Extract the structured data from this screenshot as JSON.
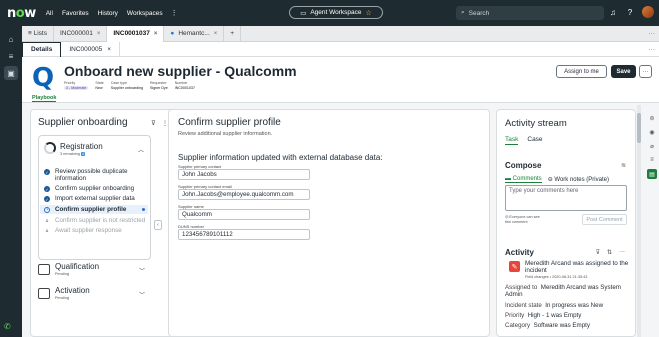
{
  "topnav": {
    "logo_main": "n",
    "logo_o": "o",
    "logo_end": "w",
    "items": [
      "All",
      "Favorites",
      "History",
      "Workspaces"
    ],
    "more": "⋮",
    "workspace_label": "Agent Workspace",
    "workspace_star": "☆",
    "search_placeholder": "Search",
    "icons": [
      "search-icon",
      "bell-icon",
      "help-icon",
      "avatar"
    ]
  },
  "tabs": [
    {
      "label": "≡ Lists"
    },
    {
      "label": "INC000001",
      "close": "×"
    },
    {
      "label": "INC0001037",
      "close": "×"
    },
    {
      "label": "Hemantc...",
      "close": "×"
    },
    {
      "label": "+"
    }
  ],
  "tab_more": "···",
  "subtabs": [
    {
      "label": "Details"
    },
    {
      "label": "INC000005",
      "close": "×"
    }
  ],
  "subtab_more": "···",
  "header": {
    "title": "Onboard new supplier - Qualcomm",
    "meta": [
      {
        "label": "Priority",
        "value": "3 - Moderate"
      },
      {
        "label": "State",
        "value": "New"
      },
      {
        "label": "Case type",
        "value": "Supplier onboarding"
      },
      {
        "label": "Requester",
        "value": "Signer Dye"
      },
      {
        "label": "Number",
        "value": "INC0001037"
      }
    ],
    "playbook_link": "Playbook",
    "assign_button": "Assign to me",
    "save_button": "Save",
    "more_button": "···"
  },
  "playbook": {
    "title": "Supplier onboarding",
    "stage": {
      "name": "Registration",
      "remaining_text": "3 remaining",
      "remaining_count": "4",
      "activities": [
        {
          "label": "Review possible duplicate information",
          "status": "done"
        },
        {
          "label": "Confirm supplier onboarding",
          "status": "done"
        },
        {
          "label": "Import external supplier data",
          "status": "done"
        },
        {
          "label": "Confirm supplier profile",
          "status": "in-progress"
        },
        {
          "label": "Confirm supplier is not restricted",
          "status": "locked"
        },
        {
          "label": "Await supplier response",
          "status": "locked"
        }
      ]
    },
    "other_stages": [
      {
        "name": "Qualification",
        "status": "Pending"
      },
      {
        "name": "Activation",
        "status": "Pending"
      }
    ]
  },
  "task": {
    "title": "Confirm supplier profile",
    "description": "Review additional supplier information.",
    "subtitle": "Supplier information updated with external database data:",
    "fields": [
      {
        "label": "Supplier primary contact",
        "value": "John Jacobs"
      },
      {
        "label": "Supplier primary contact email",
        "value": "John.Jacobs@employee.qualcomm.com"
      },
      {
        "label": "Supplier name",
        "value": "Qualcomm"
      },
      {
        "label": "DUNS number",
        "value": "123456789101112"
      }
    ]
  },
  "activity_stream": {
    "title": "Activity stream",
    "tabs": [
      "Task",
      "Case"
    ],
    "compose_title": "Compose",
    "compose_tabs": [
      "Comments",
      "Work notes (Private)"
    ],
    "compose_placeholder": "Type your comments here",
    "visibility_note": "Everyone can see this comment",
    "post_button": "Post Comment",
    "activity_title": "Activity",
    "entry": {
      "title": "Meredith Arcand was assigned to the incident",
      "time": "Field changes  •  2020-08-31 21:35:43",
      "changes": [
        {
          "key": "Assigned to",
          "value": "Meredith Arcand was System Admin"
        },
        {
          "key": "Incident state",
          "value": "In progress was New"
        },
        {
          "key": "Priority",
          "value": "High - 1 was Empty"
        },
        {
          "key": "Category",
          "value": "Software was Empty"
        }
      ]
    }
  }
}
